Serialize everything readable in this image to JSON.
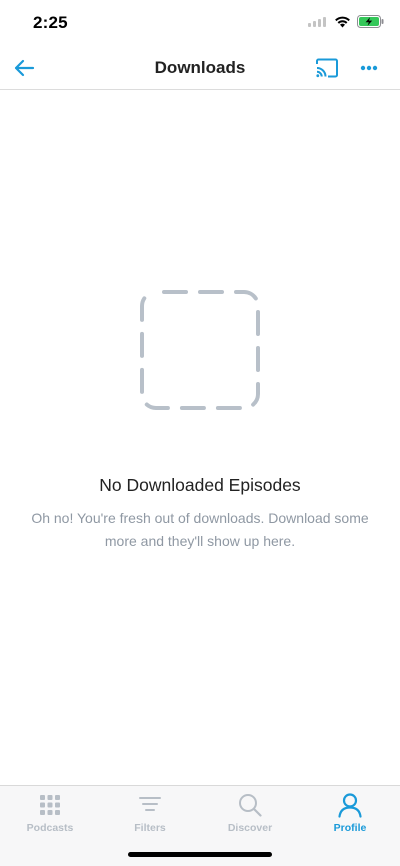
{
  "status": {
    "time": "2:25"
  },
  "nav": {
    "title": "Downloads",
    "back_icon": "arrow-left-icon",
    "cast_icon": "cast-icon",
    "more_icon": "more-horizontal-icon"
  },
  "empty_state": {
    "icon": "dashed-square-icon",
    "title": "No Downloaded Episodes",
    "description": "Oh no! You're fresh out of downloads. Download some more and they'll show up here."
  },
  "tabs": [
    {
      "label": "Podcasts",
      "icon": "grid-icon",
      "active": false
    },
    {
      "label": "Filters",
      "icon": "filter-icon",
      "active": false
    },
    {
      "label": "Discover",
      "icon": "search-icon",
      "active": false
    },
    {
      "label": "Profile",
      "icon": "profile-icon",
      "active": true
    }
  ],
  "colors": {
    "accent": "#1a9ad9",
    "inactive": "#b7bec6",
    "placeholder": "#b8c0c9",
    "battery": "#34c759"
  }
}
